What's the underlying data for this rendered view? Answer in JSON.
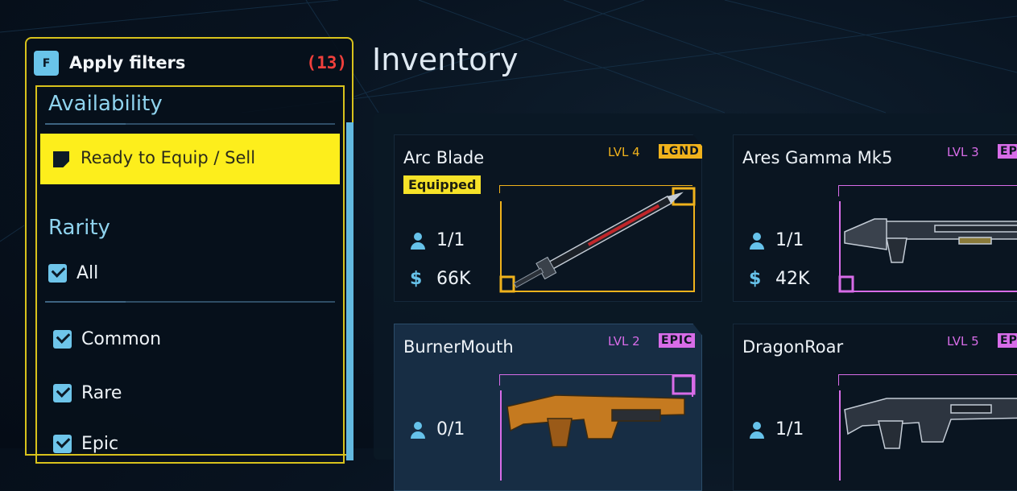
{
  "filters": {
    "key_hint": "F",
    "title": "Apply filters",
    "count": "(13)",
    "availability": {
      "title": "Availability",
      "option": "Ready to Equip / Sell"
    },
    "rarity": {
      "title": "Rarity",
      "options": [
        {
          "label": "All",
          "checked": true
        },
        {
          "label": "Common",
          "checked": true
        },
        {
          "label": "Rare",
          "checked": true
        },
        {
          "label": "Epic",
          "checked": true
        }
      ]
    }
  },
  "inventory": {
    "title": "Inventory",
    "items": [
      {
        "name": "Arc Blade",
        "level": "LVL 4",
        "rarity": "LGND",
        "equipped": "Equipped",
        "owned": "1/1",
        "price": "66K",
        "weapon": "sword",
        "rarity_color": "#f0b21c",
        "level_color": "#f0b21c"
      },
      {
        "name": "Ares Gamma Mk5",
        "level": "LVL 3",
        "rarity": "EPIC",
        "owned": "1/1",
        "price": "42K",
        "weapon": "shotgun",
        "rarity_color": "#d86ce8",
        "level_color": "#d86ce8"
      },
      {
        "name": "BurnerMouth",
        "level": "LVL 2",
        "rarity": "EPIC",
        "owned": "0/1",
        "price": "",
        "weapon": "rifle-orange",
        "rarity_color": "#d86ce8",
        "level_color": "#d86ce8"
      },
      {
        "name": "DragonRoar",
        "level": "LVL 5",
        "rarity": "EPIC",
        "owned": "1/1",
        "price": "",
        "weapon": "rifle-dark",
        "rarity_color": "#d86ce8",
        "level_color": "#d86ce8"
      }
    ]
  },
  "icons": {
    "owned": "person-icon",
    "price": "dollar-icon"
  }
}
